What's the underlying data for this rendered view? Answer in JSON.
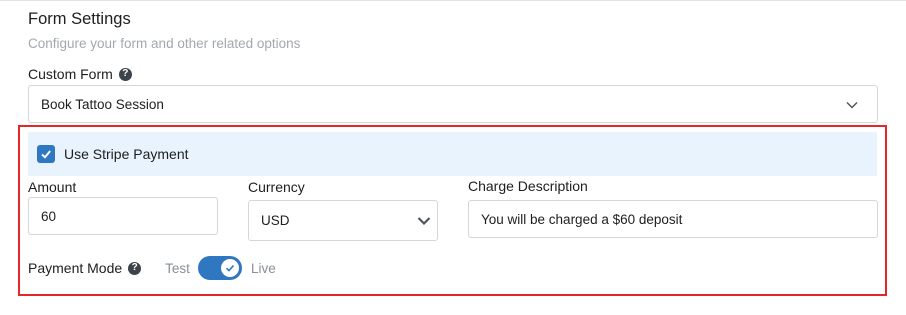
{
  "form_settings": {
    "title": "Form Settings",
    "subtitle": "Configure your form and other related options"
  },
  "custom_form": {
    "label": "Custom Form",
    "selected": "Book Tattoo Session"
  },
  "stripe": {
    "checkbox_label": "Use Stripe Payment",
    "checked": true
  },
  "amount": {
    "label": "Amount",
    "value": "60"
  },
  "currency": {
    "label": "Currency",
    "selected": "USD"
  },
  "charge_description": {
    "label": "Charge Description",
    "value": "You will be charged a $60 deposit"
  },
  "payment_mode": {
    "label": "Payment Mode",
    "test_label": "Test",
    "live_label": "Live",
    "live_enabled": true
  },
  "icons": {
    "help": "question-circle-icon",
    "chevron": "chevron-down-icon",
    "check": "check-icon"
  },
  "colors": {
    "accent": "#2f77c1",
    "highlight_border": "#e62727",
    "stripe_bar_bg": "#e9f3fd",
    "muted_text": "#a3a8ae"
  }
}
